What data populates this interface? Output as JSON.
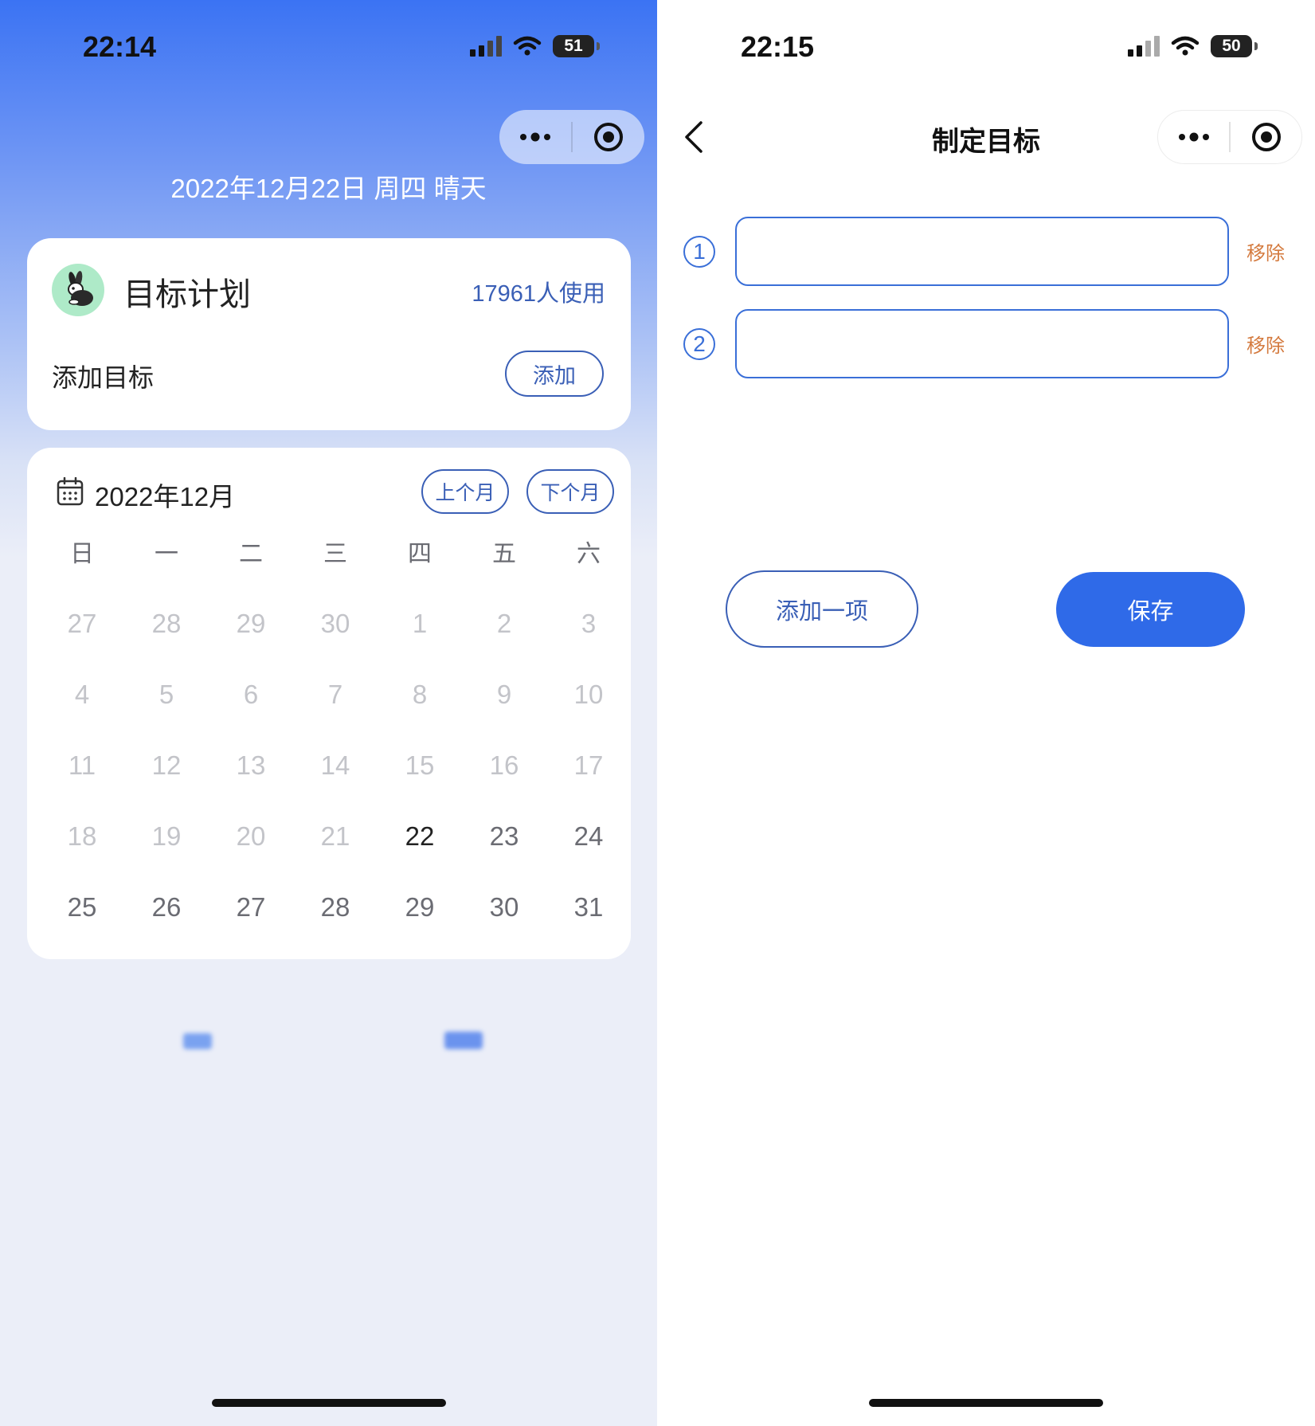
{
  "left_screen": {
    "status_bar": {
      "time": "22:14",
      "battery": "51"
    },
    "date_line": "2022年12月22日 周四 晴天",
    "plan_card": {
      "title": "目标计划",
      "user_count": "17961人使用",
      "add_label": "添加目标",
      "add_button": "添加",
      "avatar_icon": "rabbit-icon"
    },
    "calendar": {
      "month_title": "2022年12月",
      "prev_button": "上个月",
      "next_button": "下个月",
      "weekdays": [
        "日",
        "一",
        "二",
        "三",
        "四",
        "五",
        "六"
      ],
      "weeks": [
        [
          "27",
          "28",
          "29",
          "30",
          "1",
          "2",
          "3"
        ],
        [
          "4",
          "5",
          "6",
          "7",
          "8",
          "9",
          "10"
        ],
        [
          "11",
          "12",
          "13",
          "14",
          "15",
          "16",
          "17"
        ],
        [
          "18",
          "19",
          "20",
          "21",
          "22",
          "23",
          "24"
        ],
        [
          "25",
          "26",
          "27",
          "28",
          "29",
          "30",
          "31"
        ]
      ],
      "today": "22"
    }
  },
  "right_screen": {
    "status_bar": {
      "time": "22:15",
      "battery": "50"
    },
    "nav_title": "制定目标",
    "goals": [
      {
        "number": "1",
        "value": "",
        "remove_label": "移除"
      },
      {
        "number": "2",
        "value": "",
        "remove_label": "移除"
      }
    ],
    "add_item_button": "添加一项",
    "save_button": "保存"
  },
  "colors": {
    "brand_blue": "#2f6ae8",
    "outline_blue": "#3a5fb6",
    "remove_orange": "#d47a3e"
  }
}
